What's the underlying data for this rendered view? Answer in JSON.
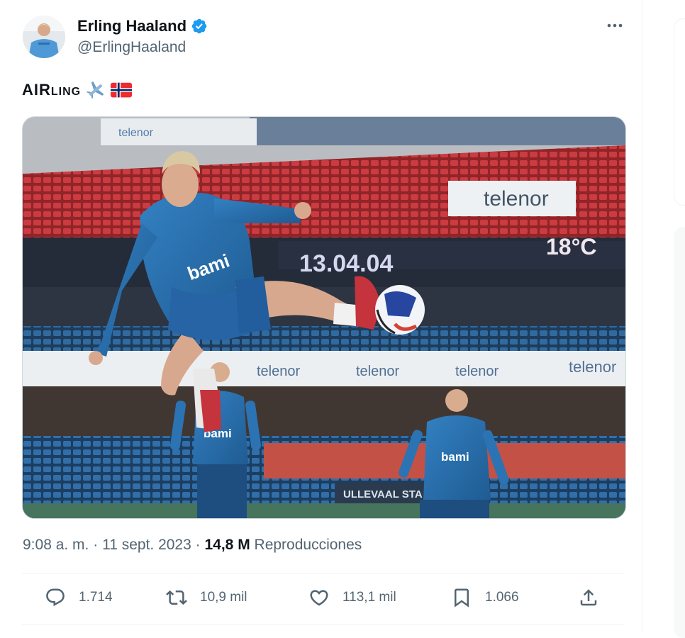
{
  "author": {
    "name": "Erling Haaland",
    "handle": "@ErlingHaaland",
    "verified": true
  },
  "tweet": {
    "text_prefix": "AIR",
    "text_suffix": "LING",
    "emojis": [
      "airplane-emoji",
      "norway-flag-emoji"
    ]
  },
  "media": {
    "scoreboard_date": "13.04.04",
    "scoreboard_temp": "18°C",
    "sponsor_board": "telenor",
    "shirt_sponsor": "bami",
    "stadium_sign": "ULLEVAAL STA"
  },
  "meta": {
    "time": "9:08 a. m.",
    "separator": "·",
    "date": "11 sept. 2023",
    "views_count": "14,8 M",
    "views_label": "Reproducciones"
  },
  "actions": {
    "reply": "1.714",
    "retweet": "10,9 mil",
    "like": "113,1 mil",
    "bookmark": "1.066"
  },
  "colors": {
    "accent": "#1d9bf0",
    "text": "#0f1419",
    "secondary": "#536471"
  }
}
